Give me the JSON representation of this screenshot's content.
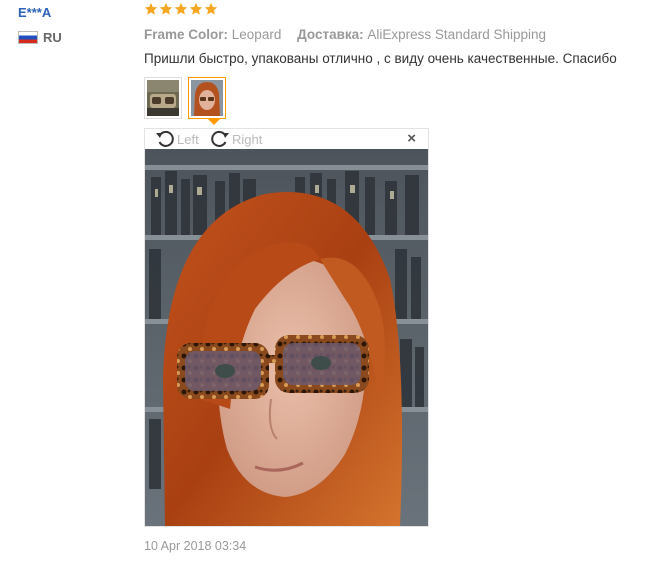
{
  "reviewer": {
    "name": "E***A",
    "country_code": "RU"
  },
  "review": {
    "rating": 5,
    "attributes": [
      {
        "label": "Frame Color:",
        "value": "Leopard"
      },
      {
        "label": "Доставка:",
        "value": "AliExpress Standard Shipping"
      }
    ],
    "text": "Пришли быстро, упакованы отлично , с виду очень качественные. Спасибо",
    "timestamp": "10 Apr 2018 03:34"
  },
  "viewer": {
    "rotate_left_label": "Left",
    "rotate_right_label": "Right",
    "close_glyph": "×",
    "thumbnails": [
      {
        "icon": "photo-thumbnail-glasses",
        "active": false
      },
      {
        "icon": "photo-thumbnail-selfie",
        "active": true
      }
    ]
  },
  "colors": {
    "star": "#f5a623",
    "username": "#2e63b8",
    "active_thumb": "#ff9900",
    "muted_text": "#999999"
  }
}
